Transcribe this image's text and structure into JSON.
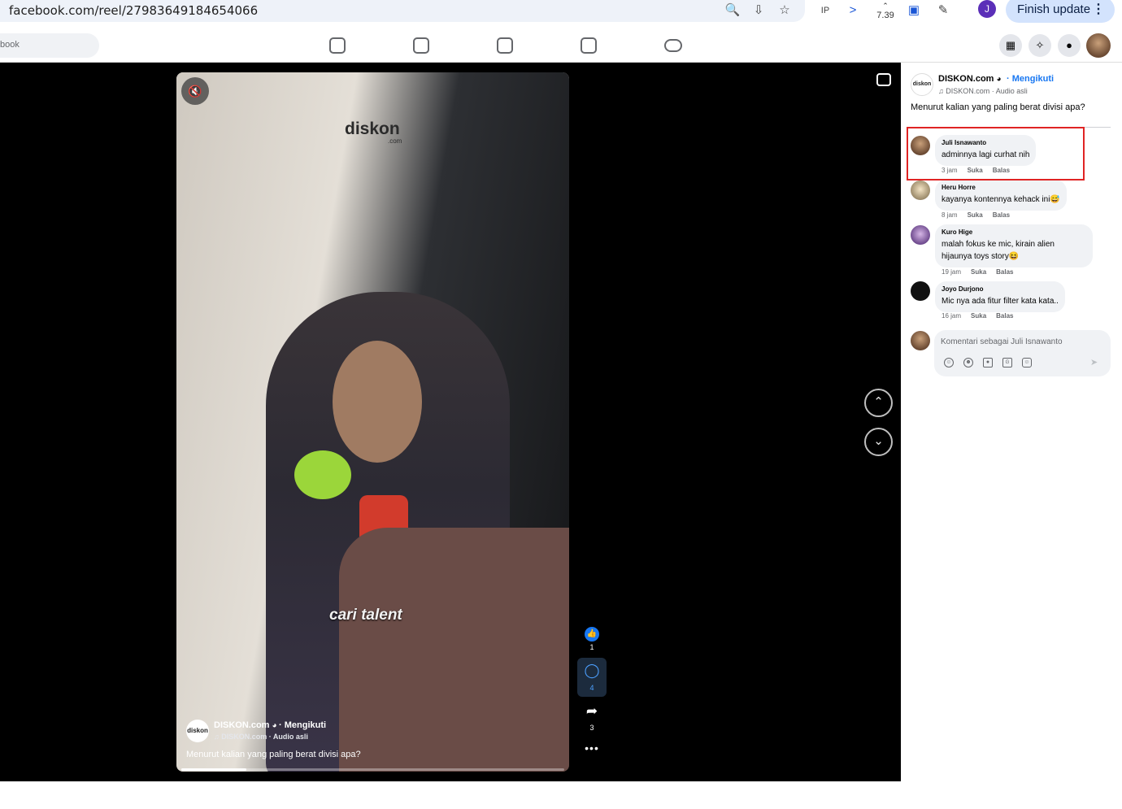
{
  "browser": {
    "url": "facebook.com/reel/27983649184654066",
    "speed_label": "7.39",
    "profile_initial": "J",
    "finish_update_label": "Finish update",
    "icons": [
      "zoom-icon",
      "install-icon",
      "star-icon",
      "ip-extension-icon",
      "chevron-right-icon",
      "speed-extension-icon",
      "media-icon",
      "puzzle-icon"
    ]
  },
  "header": {
    "search_placeholder": "book",
    "nav": [
      "home-icon",
      "reels-icon",
      "stats-icon",
      "marketplace-icon",
      "gaming-icon"
    ],
    "actions": [
      "menu-grid-icon",
      "messenger-icon",
      "bell-icon"
    ]
  },
  "reel": {
    "logo_text": "diskon",
    "logo_sub": ".com",
    "caption": "cari talent",
    "owner": "DISKON.com",
    "follow_label": "· Mengikuti",
    "audio": "♫ DISKON.com · Audio asli",
    "description": "Menurut kalian yang paling berat divisi apa?",
    "progress": 0.17,
    "likes": "1",
    "comments": "4",
    "shares": "3",
    "avatar_text": "diskon"
  },
  "panel": {
    "owner": "DISKON.com",
    "follow_label": "· Mengikuti",
    "audio": "♫ DISKON.com · Audio asli",
    "description": "Menurut kalian yang paling berat divisi apa?",
    "avatar_text": "diskon",
    "like_label": "Suka",
    "reply_label": "Balas",
    "comments": [
      {
        "name": "Juli Isnawanto",
        "text": "adminnya lagi curhat nih",
        "time": "3 jam"
      },
      {
        "name": "Heru Horre",
        "text": "kayanya kontennya kehack ini😅",
        "time": "8 jam"
      },
      {
        "name": "Kuro Hige",
        "text": "malah fokus ke mic, kirain alien hijaunya toys story😆",
        "time": "19 jam"
      },
      {
        "name": "Joyo Durjono",
        "text": "Mic nya ada fitur filter kata kata..",
        "time": "16 jam"
      }
    ],
    "input_placeholder": "Komentari sebagai Juli Isnawanto",
    "colors": {
      "accent": "#1877f2",
      "highlight": "#e02424"
    }
  }
}
